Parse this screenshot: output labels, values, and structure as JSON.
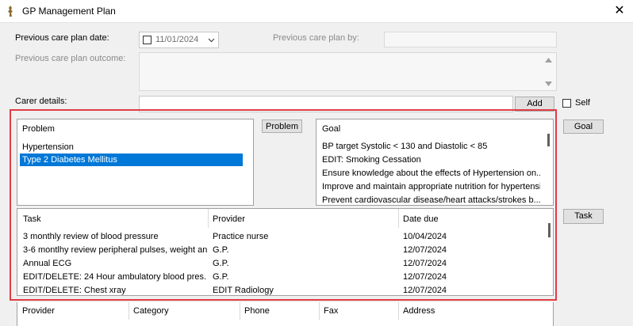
{
  "window": {
    "title": "GP Management Plan",
    "close": "✕"
  },
  "form": {
    "prev_date_label": "Previous care plan date:",
    "prev_date_value": "11/01/2024",
    "prev_by_label": "Previous care plan by:",
    "prev_outcome_label": "Previous care plan outcome:",
    "carer_label": "Carer details:",
    "add_button": "Add",
    "self_label": "Self"
  },
  "problem": {
    "button": "Problem",
    "header": "Problem",
    "items": [
      "Hypertension",
      "Type 2 Diabetes Mellitus"
    ],
    "selected_index": 1
  },
  "goal": {
    "button": "Goal",
    "header": "Goal",
    "items": [
      "BP target Systolic < 130 and Diastolic < 85",
      "EDIT: Smoking Cessation",
      "Ensure knowledge about the effects of Hypertension on...",
      "Improve and maintain appropriate nutrition for hypertensi...",
      "Prevent cardiovascular disease/heart attacks/strokes b..."
    ]
  },
  "task": {
    "button": "Task",
    "headers": [
      "Task",
      "Provider",
      "Date due"
    ],
    "rows": [
      [
        "3 monthly review of blood pressure",
        "Practice nurse",
        "10/04/2024"
      ],
      [
        "3-6 montlhy review peripheral pulses, weight an...",
        "G.P.",
        "12/07/2024"
      ],
      [
        "Annual ECG",
        "G.P.",
        "12/07/2024"
      ],
      [
        "EDIT/DELETE: 24 Hour ambulatory blood pres...",
        "G.P.",
        "12/07/2024"
      ],
      [
        "EDIT/DELETE: Chest xray",
        "EDIT Radiology",
        "12/07/2024"
      ]
    ]
  },
  "provider_table": {
    "headers": [
      "Provider",
      "Category",
      "Phone",
      "Fax",
      "Address"
    ]
  }
}
